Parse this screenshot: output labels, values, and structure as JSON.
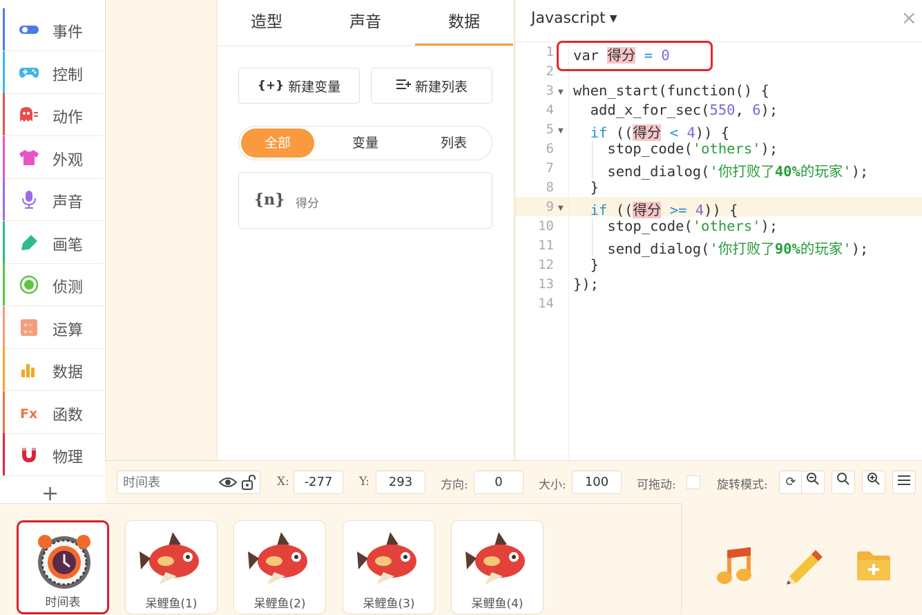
{
  "sidebar": {
    "items": [
      {
        "label": "事件",
        "icon": "toggle-icon",
        "color": "#4c7be8"
      },
      {
        "label": "控制",
        "icon": "gamepad-icon",
        "color": "#3fb5e8"
      },
      {
        "label": "动作",
        "icon": "ghost-icon",
        "color": "#e84c4c"
      },
      {
        "label": "外观",
        "icon": "shirt-icon",
        "color": "#e854c9"
      },
      {
        "label": "声音",
        "icon": "microphone-icon",
        "color": "#9b6ae8"
      },
      {
        "label": "画笔",
        "icon": "pen-icon",
        "color": "#2dbd8a"
      },
      {
        "label": "侦测",
        "icon": "target-icon",
        "color": "#5ec444"
      },
      {
        "label": "运算",
        "icon": "calculator-icon",
        "color": "#f59c7a"
      },
      {
        "label": "数据",
        "icon": "bar-chart-icon",
        "color": "#f5a623"
      },
      {
        "label": "函数",
        "icon": "function-icon",
        "color": "#f0724a"
      },
      {
        "label": "物理",
        "icon": "magnet-icon",
        "color": "#d9263b"
      }
    ],
    "add_label": "+"
  },
  "middle": {
    "tabs": [
      "造型",
      "声音",
      "数据"
    ],
    "active_tab": "数据",
    "new_variable_icon": "{+}",
    "new_variable_label": "新建变量",
    "new_list_label": "新建列表",
    "filters": [
      "全部",
      "变量",
      "列表"
    ],
    "active_filter": "全部",
    "variable_icon": "{n}",
    "variable_name": "得分"
  },
  "code": {
    "language": "Javascript",
    "close": "×",
    "line_numbers": [
      "1",
      "2",
      "3",
      "4",
      "5",
      "6",
      "7",
      "8",
      "9",
      "10",
      "11",
      "12",
      "13",
      "14"
    ]
  },
  "props": {
    "name_placeholder": "时间表",
    "x_label": "X:",
    "x_value": "-277",
    "y_label": "Y:",
    "y_value": "293",
    "direction_label": "方向:",
    "direction_value": "0",
    "size_label": "大小:",
    "size_value": "100",
    "draggable_label": "可拖动:",
    "rotation_label": "旋转模式:"
  },
  "sprites": [
    {
      "name": "时间表",
      "selected": true
    },
    {
      "name": "呆鲤鱼(1)",
      "selected": false
    },
    {
      "name": "呆鲤鱼(2)",
      "selected": false
    },
    {
      "name": "呆鲤鱼(3)",
      "selected": false
    },
    {
      "name": "呆鲤鱼(4)",
      "selected": false
    }
  ],
  "colors": {
    "accent": "#f99a3f",
    "highlight": "#e0282d"
  }
}
